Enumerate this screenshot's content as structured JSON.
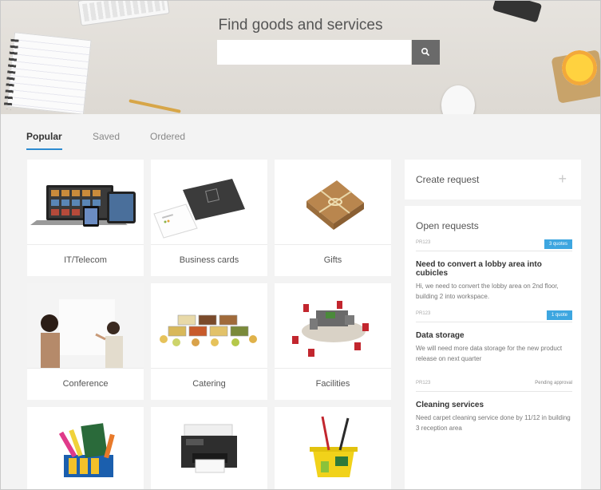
{
  "hero": {
    "title": "Find goods and services",
    "search_placeholder": ""
  },
  "tabs": [
    {
      "label": "Popular",
      "active": true
    },
    {
      "label": "Saved",
      "active": false
    },
    {
      "label": "Ordered",
      "active": false
    }
  ],
  "tiles": [
    {
      "label": "IT/Telecom",
      "icon": "devices-icon"
    },
    {
      "label": "Business cards",
      "icon": "business-cards-icon"
    },
    {
      "label": "Gifts",
      "icon": "gift-box-icon"
    },
    {
      "label": "Conference",
      "icon": "meeting-people-icon"
    },
    {
      "label": "Catering",
      "icon": "food-trays-icon"
    },
    {
      "label": "Facilities",
      "icon": "office-desk-icon"
    },
    {
      "label": "",
      "icon": "markers-icon"
    },
    {
      "label": "",
      "icon": "printer-icon"
    },
    {
      "label": "",
      "icon": "cleaning-bucket-icon"
    }
  ],
  "right_panel": {
    "create_label": "Create request",
    "open_title": "Open requests",
    "requests": [
      {
        "id": "PR123",
        "badge": "3 quotes",
        "status": "",
        "title": "Need to convert a lobby area into cubicles",
        "desc": "Hi, we need to convert the lobby area on 2nd floor, building 2 into workspace."
      },
      {
        "id": "PR123",
        "badge": "1 quote",
        "status": "",
        "title": "Data storage",
        "desc": "We will need more data storage for the new product release on next quarter"
      },
      {
        "id": "PR123",
        "badge": "",
        "status": "Pending approval",
        "title": "Cleaning services",
        "desc": "Need carpet cleaning service done by 11/12 in building 3 reception area"
      }
    ]
  },
  "colors": {
    "accent": "#2d8bd0",
    "badge": "#3da6e0",
    "search_button": "#6a6a6a"
  }
}
